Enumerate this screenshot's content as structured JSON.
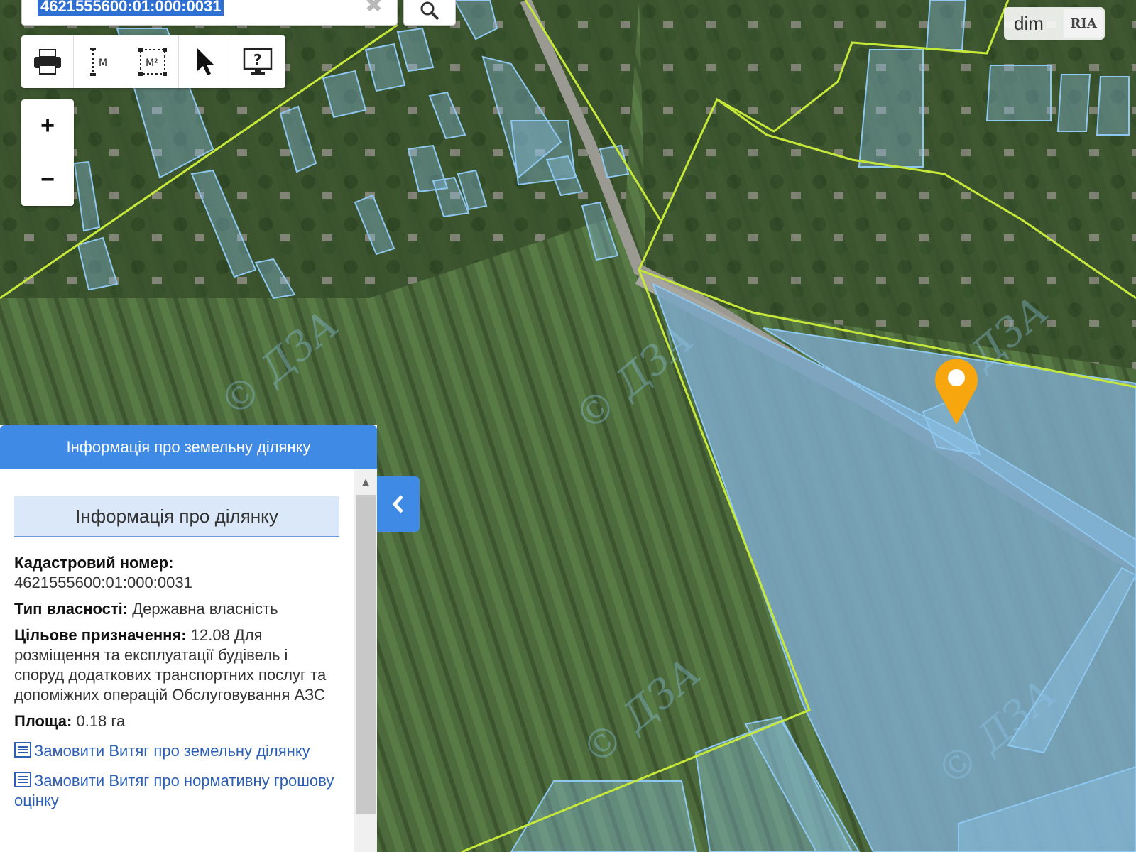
{
  "search": {
    "query": "4621555600:01:000:0031",
    "clear_icon": "close-icon",
    "search_icon": "magnifier-icon"
  },
  "toolbar": {
    "tools": [
      {
        "icon": "print-icon"
      },
      {
        "icon": "measure-length-icon",
        "label": "M"
      },
      {
        "icon": "measure-area-icon",
        "label": "M²"
      },
      {
        "icon": "cursor-icon"
      },
      {
        "icon": "help-monitor-icon",
        "label": "?"
      }
    ]
  },
  "zoom": {
    "in_label": "+",
    "out_label": "−"
  },
  "watermark": {
    "brand": "dim",
    "brand_badge": "RIA",
    "overlay_text": "© ДЗА"
  },
  "panel": {
    "header": "Інформація про земельну ділянку",
    "subheader": "Інформація про ділянку",
    "cadastral_label": "Кадастровий номер:",
    "cadastral_value": "4621555600:01:000:0031",
    "ownership_label": "Тип власності:",
    "ownership_value": "Державна власність",
    "purpose_label": "Цільове призначення:",
    "purpose_value": "12.08 Для розміщення та експлуатації будівель і споруд додаткових транспортних послуг та допоміжних операцій Обслуговування АЗС",
    "area_label": "Площа:",
    "area_value": "0.18 га",
    "link1": "Замовити Витяг про земельну ділянку",
    "link2": "Замовити Витяг про нормативну грошову оцінку"
  },
  "colors": {
    "accent": "#3e8ae4",
    "boundary_green": "#c6e83a",
    "parcel_blue": "#8ec8f0",
    "marker": "#f7a60e"
  }
}
